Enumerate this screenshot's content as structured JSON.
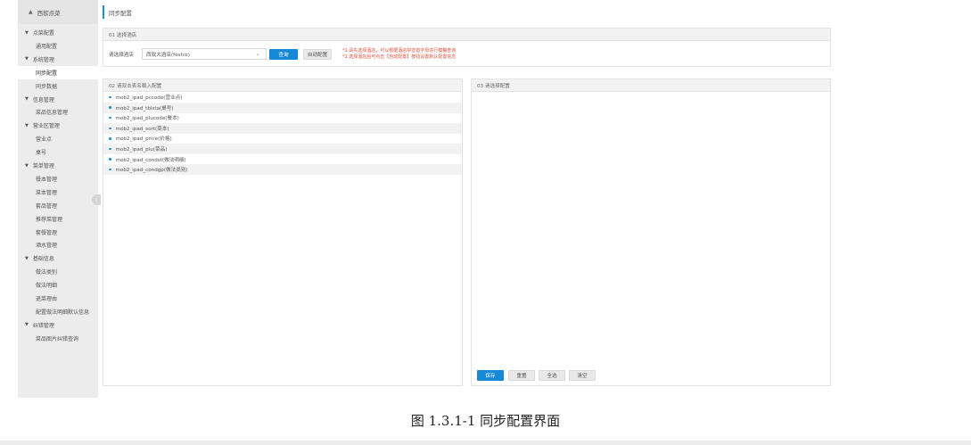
{
  "sidebar": {
    "top_label": "西软点菜",
    "top_icon": "home-icon",
    "items": [
      {
        "label": "点菜配置",
        "type": "group"
      },
      {
        "label": "通用配置",
        "type": "child"
      },
      {
        "label": "系统管理",
        "type": "group"
      },
      {
        "label": "同步配置",
        "type": "child",
        "active": true
      },
      {
        "label": "同步数据",
        "type": "child"
      },
      {
        "label": "信息管理",
        "type": "group"
      },
      {
        "label": "菜品信息管理",
        "type": "child"
      },
      {
        "label": "营业区管理",
        "type": "group"
      },
      {
        "label": "营业点",
        "type": "child"
      },
      {
        "label": "桌号",
        "type": "child"
      },
      {
        "label": "菜单管理",
        "type": "group"
      },
      {
        "label": "餐本管理",
        "type": "child"
      },
      {
        "label": "菜本管理",
        "type": "child"
      },
      {
        "label": "套品管理",
        "type": "child"
      },
      {
        "label": "推荐菜管理",
        "type": "child"
      },
      {
        "label": "套餐管理",
        "type": "child"
      },
      {
        "label": "酒水管理",
        "type": "child"
      },
      {
        "label": "基础信息",
        "type": "group"
      },
      {
        "label": "做法类别",
        "type": "child"
      },
      {
        "label": "做法明细",
        "type": "child"
      },
      {
        "label": "退菜理由",
        "type": "child"
      },
      {
        "label": "配置做法明细默认信息",
        "type": "child"
      },
      {
        "label": "纠错管理",
        "type": "group"
      },
      {
        "label": "菜品图片纠错查询",
        "type": "child"
      }
    ]
  },
  "header": {
    "title": "同步配置"
  },
  "panel1": {
    "title": "01 选择酒店",
    "label": "请选择酒店",
    "hotel_value": "西软大酒店(foxhis)",
    "query_label": "查询",
    "auto_label": "自动配置",
    "tip1": "*1.请先选择酒店，可以根据酒店拼音首字母进行模糊查询",
    "tip2": "*2.选择酒店后可点击【自动配置】按钮设置默认配置信息"
  },
  "panel2": {
    "title": "02 请双击表名载入配置",
    "rows": [
      "mob2_ipad_pccode(营业点)",
      "mob2_ipad_tblsta(桌号)",
      "mob2_ipad_plucode(餐本)",
      "mob2_ipad_sort(菜本)",
      "mob2_ipad_price(价格)",
      "mob2_ipad_plu(菜品)",
      "mob2_ipad_condst(做法明细)",
      "mob2_ipad_condgp(做法类别)"
    ]
  },
  "panel3": {
    "title": "03 请选择配置",
    "save_label": "保存",
    "reset_label": "重置",
    "select_all_label": "全选",
    "clear_label": "清空"
  },
  "caption": "图 1.3.1-1 同步配置界面",
  "colors": {
    "accent": "#1689d6",
    "tip": "#e2523b",
    "sidebar_bg": "#ececec"
  }
}
